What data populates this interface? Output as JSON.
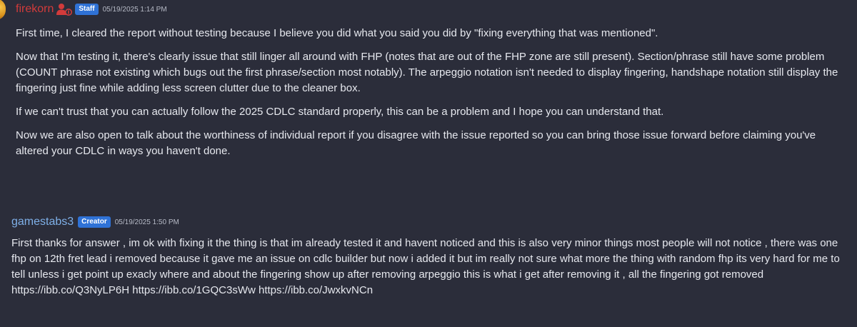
{
  "posts": [
    {
      "author": "firekorn",
      "author_color": "#d23b3b",
      "role_icon": "staff-user-icon",
      "badge": "Staff",
      "badge_color": "#2f72d6",
      "timestamp": "05/19/2025 1:14 PM",
      "paragraphs": [
        "First time, I cleared the report without testing because I believe you did what you said you did by \"fixing everything that was mentioned\".",
        "Now that I'm testing it, there's clearly issue that still linger all around with FHP (notes that are out of the FHP zone are still present). Section/phrase still have some problem (COUNT phrase not existing which bugs out the first phrase/section most notably). The arpeggio notation isn't needed to display fingering, handshape notation still display the fingering just fine while adding less screen clutter due to the cleaner box.",
        "If we can't trust that you can actually follow the 2025 CDLC standard properly, this can be a problem and I hope you can understand that.",
        "Now we are also open to talk about the worthiness of individual report if you disagree with the issue reported so you can bring those issue forward before claiming you've altered your CDLC in ways you haven't done."
      ]
    },
    {
      "author": "gamestabs3",
      "author_color": "#7fb0e8",
      "badge": "Creator",
      "badge_color": "#2f72d6",
      "timestamp": "05/19/2025 1:50 PM",
      "paragraphs": [
        "First thanks for answer , im ok with fixing it the thing is that im already tested it and havent noticed and this is also very minor things most people will not notice , there was one fhp on 12th fret lead i removed because it gave me an issue on cdlc builder but now i added it but im really not sure what more the thing with random fhp its very hard for me to tell unless i get point up exacly where and about the fingering show up after removing arpeggio this is what i get after removing it , all the fingering got removed https://ibb.co/Q3NyLP6H https://ibb.co/1GQC3sWw https://ibb.co/JwxkvNCn"
      ]
    }
  ]
}
